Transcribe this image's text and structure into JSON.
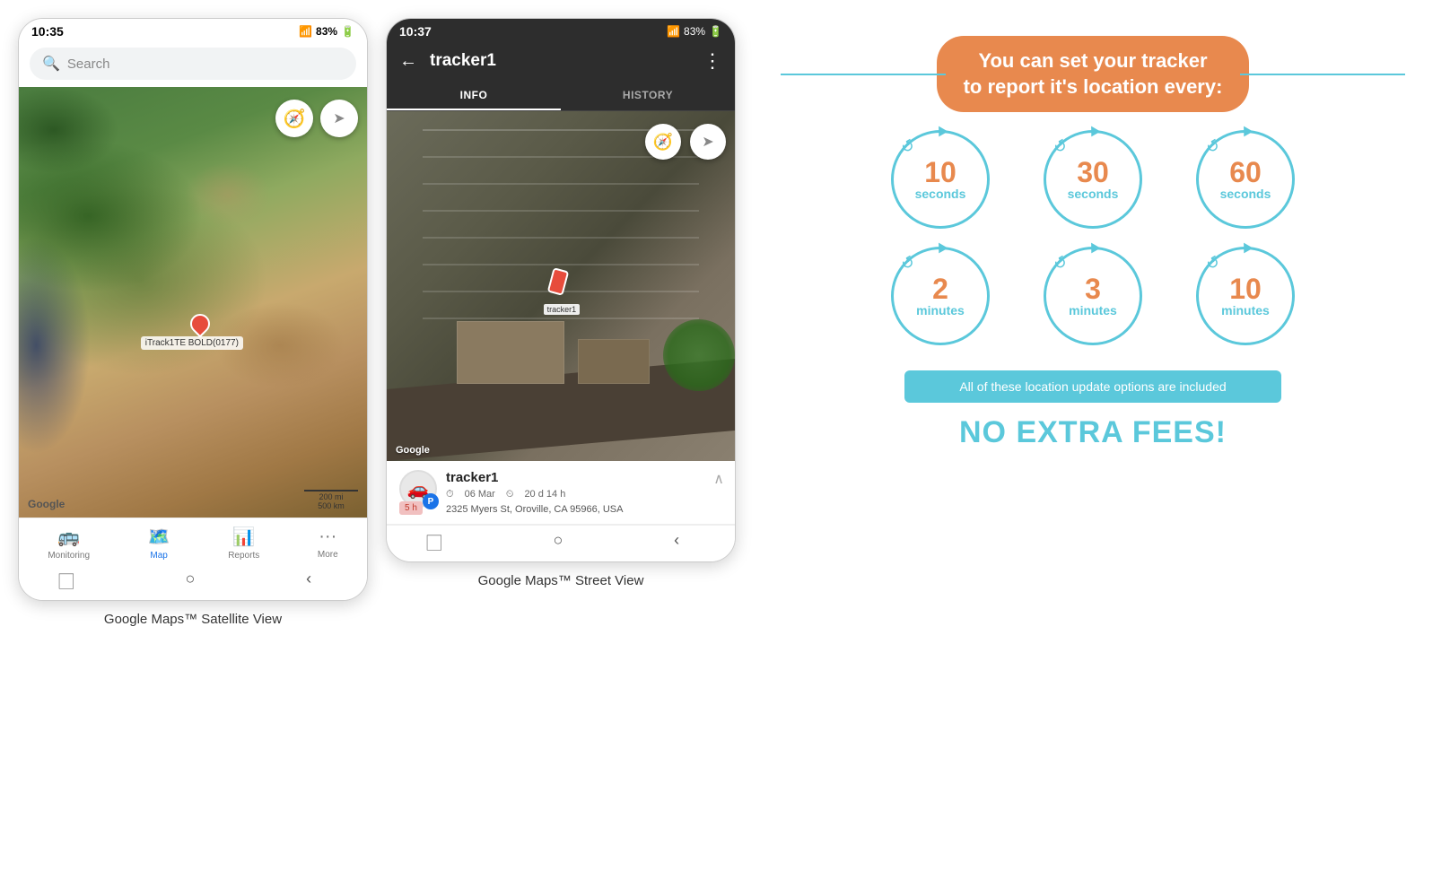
{
  "phone1": {
    "status_bar": {
      "time": "10:35",
      "signal": "📶",
      "wifi": "▲▼",
      "battery": "83%",
      "battery_icon": "🔋"
    },
    "search": {
      "placeholder": "Search"
    },
    "map": {
      "compass_icon": "🧭",
      "navigate_icon": "➤",
      "tracker_label": "iTrack1TE BOLD(0177)",
      "google_label": "Google",
      "scale_200mi": "200 mi",
      "scale_500km": "500 km"
    },
    "bottom_nav": {
      "items": [
        {
          "icon": "🚌",
          "label": "Monitoring",
          "active": false
        },
        {
          "icon": "🗺️",
          "label": "Map",
          "active": true
        },
        {
          "icon": "📊",
          "label": "Reports",
          "active": false
        },
        {
          "icon": "···",
          "label": "More",
          "active": false
        }
      ]
    },
    "caption": "Google Maps™ Satellite View"
  },
  "phone2": {
    "status_bar": {
      "time": "10:37",
      "battery": "83%"
    },
    "header": {
      "back_icon": "←",
      "tracker_name": "tracker1",
      "menu_icon": "⋮"
    },
    "tabs": [
      {
        "label": "INFO",
        "active": true
      },
      {
        "label": "HISTORY",
        "active": false
      }
    ],
    "map": {
      "compass_icon": "🧭",
      "navigate_icon": "➤",
      "google_label": "Google",
      "tracker_label": "tracker1"
    },
    "info": {
      "avatar_icon": "🚗",
      "avatar_letter": "P",
      "name": "tracker1",
      "date": "06 Mar",
      "duration": "20 d 14 h",
      "address": "2325 Myers St, Oroville, CA 95966, USA",
      "age_badge": "5 h"
    },
    "caption": "Google Maps™ Street View"
  },
  "info_graphic": {
    "title_line1": "You can set your tracker",
    "title_line2": "to report it's location every:",
    "circles": [
      {
        "number": "10",
        "unit": "seconds"
      },
      {
        "number": "30",
        "unit": "seconds"
      },
      {
        "number": "60",
        "unit": "seconds"
      },
      {
        "number": "2",
        "unit": "minutes"
      },
      {
        "number": "3",
        "unit": "minutes"
      },
      {
        "number": "10",
        "unit": "minutes"
      }
    ],
    "banner_text": "All of these location update options are included",
    "no_fees_text": "NO EXTRA FEES!"
  }
}
